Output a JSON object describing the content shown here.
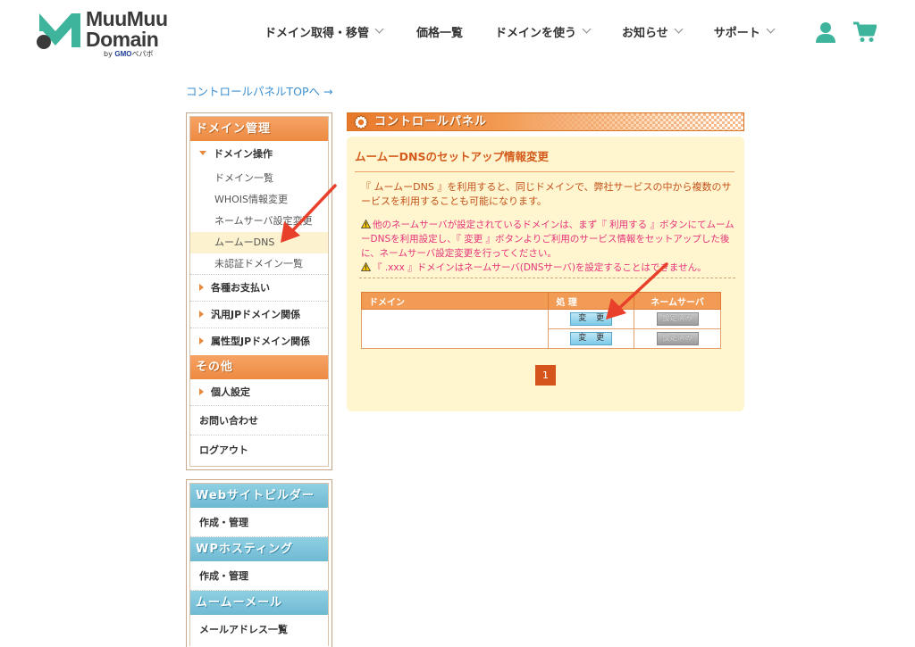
{
  "brand": {
    "line1": "MuuMuu",
    "line2": "Domain",
    "by": "by",
    "gmo": "GMO",
    "pepabo": "ペパボ",
    "teal": "#3fb49c",
    "dark": "#3a3a3a"
  },
  "nav": {
    "items": [
      {
        "label": "ドメイン取得・移管",
        "chevron": true
      },
      {
        "label": "価格一覧",
        "chevron": false
      },
      {
        "label": "ドメインを使う",
        "chevron": true
      },
      {
        "label": "お知らせ",
        "chevron": true
      },
      {
        "label": "サポート",
        "chevron": true
      }
    ],
    "icons": [
      "user-icon",
      "cart-icon"
    ],
    "icon_color": "#3fb49c"
  },
  "top_link": "コントロールパネルTOPへ →",
  "sidebar": {
    "domain_head": "ドメイン管理",
    "domain_ops": "ドメイン操作",
    "domain_sub": [
      "ドメイン一覧",
      "WHOIS情報変更",
      "ネームサーバ設定変更",
      "ムームーDNS",
      "未認証ドメイン一覧"
    ],
    "payments": "各種お支払い",
    "jp": "汎用JPドメイン関係",
    "attr_jp": "属性型JPドメイン関係",
    "other_head": "その他",
    "personal": "個人設定",
    "contact": "お問い合わせ",
    "logout": "ログアウト",
    "web_head": "Webサイトビルダー",
    "web_item": "作成・管理",
    "wp_head": "WPホスティング",
    "wp_item": "作成・管理",
    "mail_head": "ムームーメール",
    "mail_item": "メールアドレス一覧"
  },
  "banner": "コントロールパネル",
  "panel": {
    "title": "ムームーDNSのセットアップ情報変更",
    "desc": "『 ムームーDNS 』を利用すると、同じドメインで、弊社サービスの中から複数のサービスを利用することも可能になります。",
    "note1": "他のネームサーバが設定されているドメインは、まず『 利用する 』ボタンにてムームーDNSを利用設定し、『 変更 』ボタンよりご利用のサービス情報をセットアップした後に、ネームサーバ設定変更を行ってください。",
    "note2": "『 .xxx 』ドメインはネームサーバ(DNSサーバ)を設定することはできません。"
  },
  "table": {
    "headers": [
      "ドメイン",
      "処 理",
      "ネームサーバ"
    ],
    "rows": [
      {
        "domain": "",
        "action": "変 更",
        "ns": "設定済み"
      },
      {
        "domain": "",
        "action": "変 更",
        "ns": "設定済み"
      }
    ]
  },
  "pager": "1",
  "colors": {
    "accent_orange": "#e8782a",
    "link_blue": "#3b8fd1",
    "panel_bg": "#fff5cf",
    "note_pink": "#e6337a",
    "arrow_red": "#e8402a"
  }
}
